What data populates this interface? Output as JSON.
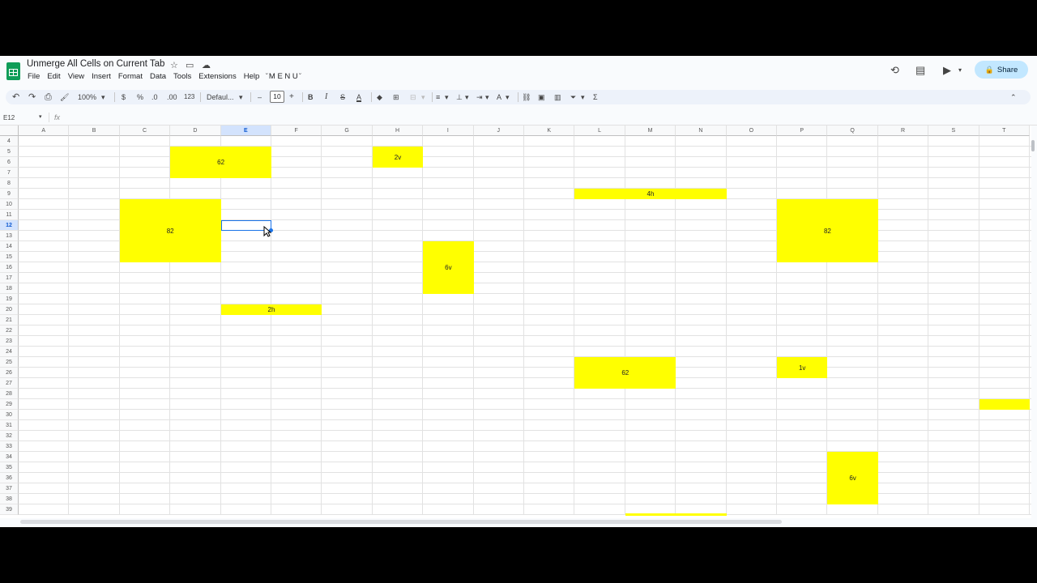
{
  "title": "Unmerge All Cells on Current Tab",
  "icons": {
    "star": "star-icon",
    "folder": "move-to-folder-icon",
    "cloud": "cloud-saved-icon"
  },
  "menu": [
    "File",
    "Edit",
    "View",
    "Insert",
    "Format",
    "Data",
    "Tools",
    "Extensions",
    "Help",
    "̆ M E N U ̆"
  ],
  "share_label": "Share",
  "toolbar": {
    "zoom": "100%",
    "currency": "$",
    "percent": "%",
    "dec_decrease": ".0",
    "dec_increase": ".00",
    "number_format": "123",
    "font": "Defaul...",
    "font_size": "10",
    "bold": "B",
    "italic": "I",
    "strike": "S",
    "text_color": "A",
    "sum": "Σ",
    "undo": "↶",
    "redo": "↷",
    "print": "⎙",
    "paint": "🖌",
    "minus": "–",
    "plus": "+",
    "caret": "▾",
    "collapse": "⌃"
  },
  "name_box": "E12",
  "fx": "fx",
  "columns": [
    "A",
    "B",
    "C",
    "D",
    "E",
    "F",
    "G",
    "H",
    "I",
    "J",
    "K",
    "L",
    "M",
    "N",
    "O",
    "P",
    "Q",
    "R",
    "S",
    "T"
  ],
  "selected_column": "E",
  "rows": [
    "4",
    "5",
    "6",
    "7",
    "8",
    "9",
    "10",
    "11",
    "12",
    "13",
    "14",
    "15",
    "16",
    "17",
    "18",
    "19",
    "20",
    "21",
    "22",
    "23",
    "24",
    "25",
    "26",
    "27",
    "28",
    "29",
    "30",
    "31",
    "32",
    "33",
    "34",
    "35",
    "36",
    "37",
    "38",
    "39"
  ],
  "selected_row": "12",
  "cells": {
    "d5": "62",
    "h5": "2v",
    "l9": "4h",
    "c10": "82",
    "p10": "82",
    "i14": "6v",
    "e20": "2h",
    "l25": "62",
    "p25": "1v",
    "t29": "",
    "q34": "6v"
  },
  "fill_color": "#ffff00",
  "accent": "#1a73e8"
}
